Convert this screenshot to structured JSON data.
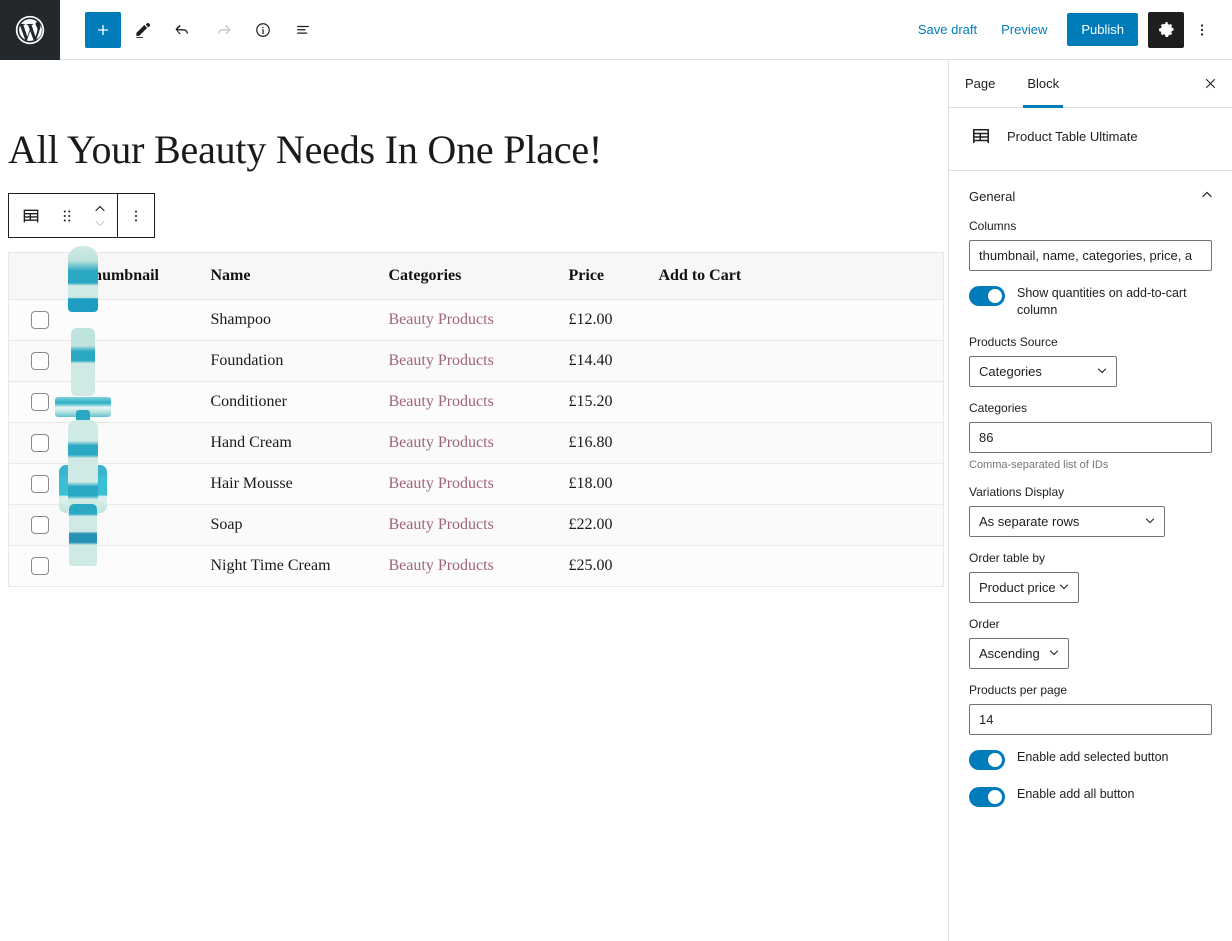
{
  "topbar": {
    "logo_icon": "wordpress-logo-icon",
    "left_tools": [
      {
        "name": "add-block-button",
        "icon": "plus-icon",
        "label": "Add block",
        "state": "primary"
      },
      {
        "name": "edit-tool-button",
        "icon": "pencil-icon",
        "label": "Edit",
        "state": "normal"
      },
      {
        "name": "undo-button",
        "icon": "undo-arrow-icon",
        "label": "Undo",
        "state": "normal"
      },
      {
        "name": "redo-button",
        "icon": "redo-arrow-icon",
        "label": "Redo",
        "state": "disabled"
      },
      {
        "name": "details-button",
        "icon": "info-circle-icon",
        "label": "Details",
        "state": "normal"
      },
      {
        "name": "list-view-button",
        "icon": "list-view-icon",
        "label": "List view",
        "state": "normal"
      }
    ],
    "save_draft_label": "Save draft",
    "preview_label": "Preview",
    "publish_label": "Publish",
    "settings_icon": "gear-icon",
    "options_icon": "vertical-dots-icon",
    "accent_color": "#007cba",
    "logo_bg": "#23282d"
  },
  "canvas": {
    "page_heading": "All Your Beauty Needs In One Place!",
    "block_toolbar": {
      "block_type_icon": "table-block-icon",
      "drag_icon": "drag-handle-icon",
      "move_up_icon": "chevron-up-icon",
      "move_down_icon": "chevron-down-icon",
      "options_icon": "vertical-dots-icon"
    }
  },
  "table": {
    "columns": [
      "",
      "Thumbnail",
      "Name",
      "Categories",
      "Price",
      "Add to Cart"
    ],
    "rows": [
      {
        "checkbox": false,
        "thumb": "shampoo-tube-thumbnail",
        "shape": "tube",
        "name": "Shampoo",
        "category": "Beauty Products",
        "price": "£12.00",
        "cart": ""
      },
      {
        "checkbox": false,
        "thumb": "foundation-box-thumbnail",
        "shape": "box",
        "name": "Foundation",
        "category": "Beauty Products",
        "price": "£14.40",
        "cart": ""
      },
      {
        "checkbox": false,
        "thumb": "conditioner-bottle-thumbnail",
        "shape": "bottle",
        "name": "Conditioner",
        "category": "Beauty Products",
        "price": "£15.20",
        "cart": ""
      },
      {
        "checkbox": false,
        "thumb": "hand-cream-jar-thumbnail",
        "shape": "jar",
        "name": "Hand Cream",
        "category": "Beauty Products",
        "price": "£16.80",
        "cart": ""
      },
      {
        "checkbox": false,
        "thumb": "hair-mousse-pump-thumbnail",
        "shape": "pump",
        "name": "Hair Mousse",
        "category": "Beauty Products",
        "price": "£18.00",
        "cart": ""
      },
      {
        "checkbox": false,
        "thumb": "soap-pump-thumbnail",
        "shape": "pump",
        "name": "Soap",
        "category": "Beauty Products",
        "price": "£22.00",
        "cart": ""
      },
      {
        "checkbox": false,
        "thumb": "night-time-cream-can-thumbnail",
        "shape": "can",
        "name": "Night Time Cream",
        "category": "Beauty Products",
        "price": "£25.00",
        "cart": ""
      }
    ],
    "category_link_color": "#a0637d",
    "header_bg": "#f7f7f7"
  },
  "sidebar": {
    "tabs": [
      {
        "label": "Page",
        "active": false
      },
      {
        "label": "Block",
        "active": true
      }
    ],
    "close_icon": "close-icon",
    "block": {
      "icon": "table-block-icon",
      "title": "Product Table Ultimate"
    },
    "panel": {
      "title": "General",
      "collapse_icon": "chevron-up-icon",
      "columns": {
        "label": "Columns",
        "value": "thumbnail, name, categories, price, a"
      },
      "show_quantities": {
        "label": "Show quantities on add-to-cart column",
        "on": true
      },
      "products_source": {
        "label": "Products Source",
        "value": "Categories"
      },
      "categories": {
        "label": "Categories",
        "value": "86",
        "help": "Comma-separated list of IDs"
      },
      "variations_display": {
        "label": "Variations Display",
        "value": "As separate rows"
      },
      "order_table_by": {
        "label": "Order table by",
        "value": "Product price"
      },
      "order": {
        "label": "Order",
        "value": "Ascending"
      },
      "products_per_page": {
        "label": "Products per page",
        "value": "14"
      },
      "enable_add_selected": {
        "label": "Enable add selected button",
        "on": true
      },
      "enable_add_all": {
        "label": "Enable add all button",
        "on": true
      }
    }
  }
}
